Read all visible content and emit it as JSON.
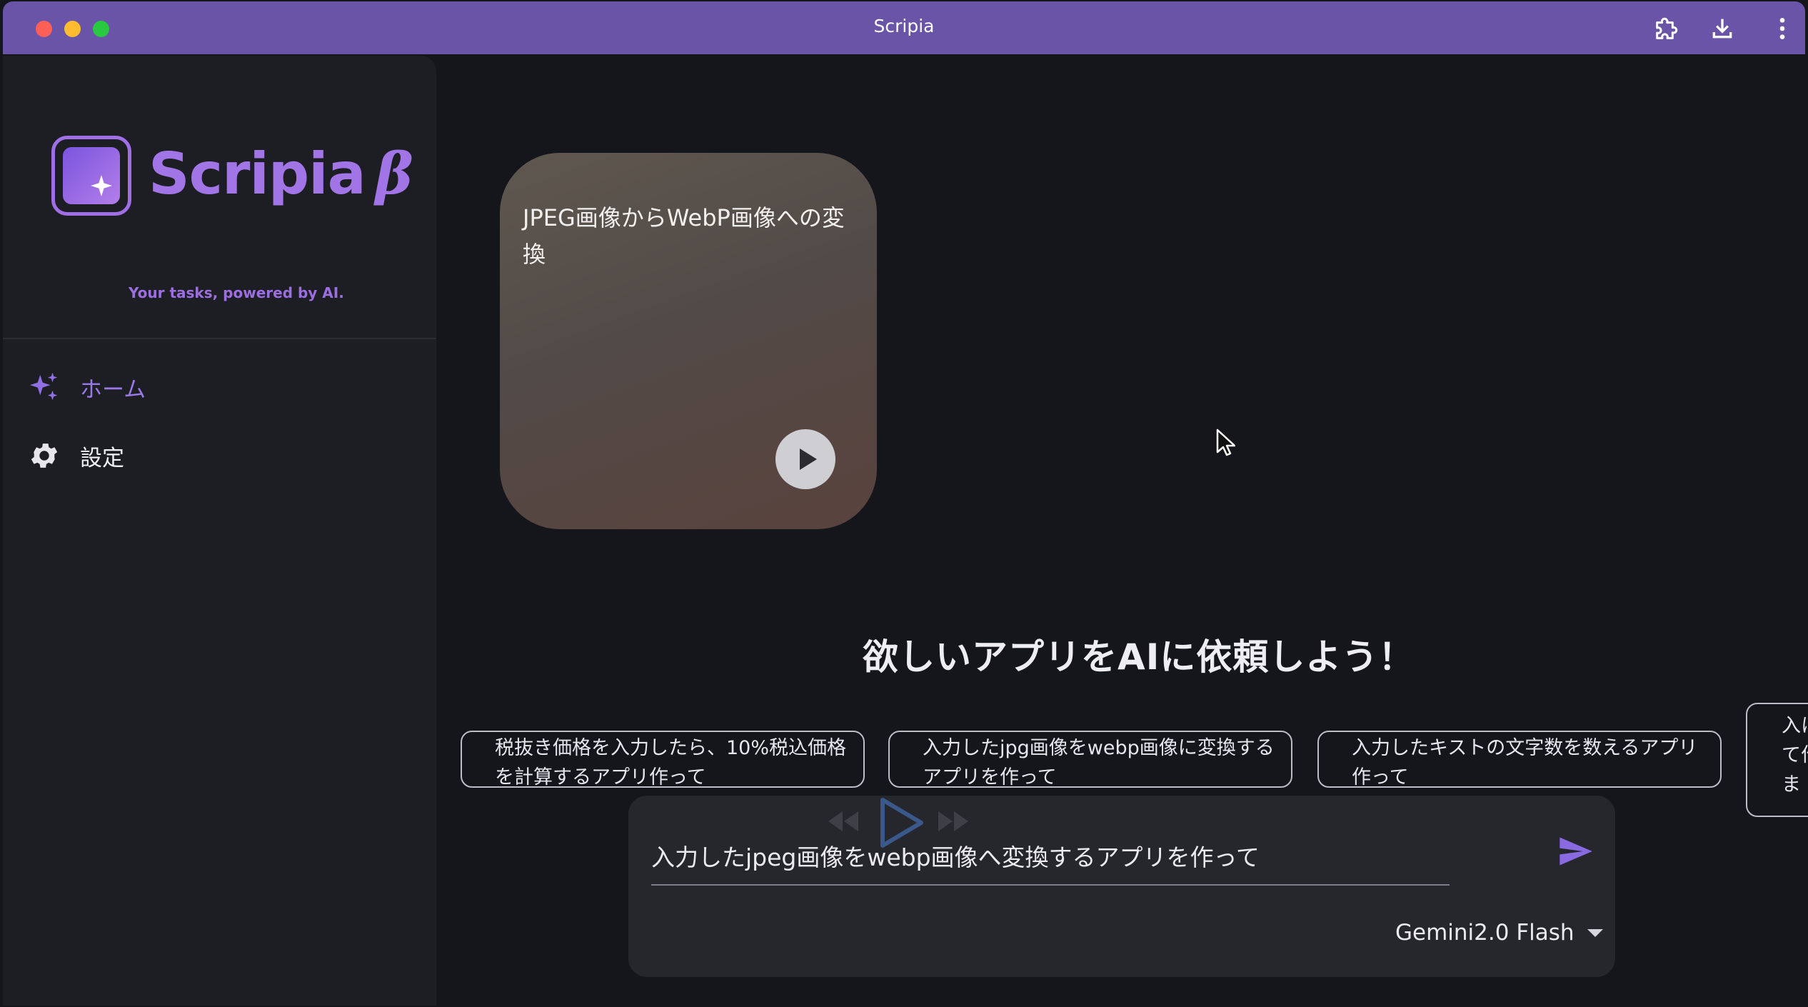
{
  "window": {
    "title": "Scripia",
    "titlebar_color": "#6a54a8",
    "icons": [
      "extension-icon",
      "download-icon",
      "more-vert-icon"
    ]
  },
  "sidebar": {
    "logo_text": "Scripia",
    "logo_beta": "β",
    "tagline": "Your tasks, powered by AI.",
    "accent_color": "#a275e6",
    "nav": [
      {
        "label": "ホーム",
        "icon": "sparkle-icon",
        "active": true
      },
      {
        "label": "設定",
        "icon": "gear-icon",
        "active": false
      }
    ]
  },
  "main": {
    "card": {
      "title": "JPEG画像からWebP画像への変換",
      "action_icon": "play-icon"
    },
    "heading": "欲しいアプリをAIに依頼しよう！",
    "suggestions": [
      "税抜き価格を入力したら、10%税込価格を計算するアプリ作って",
      "入力したjpg画像をwebp画像に変換するアプリを作って",
      "入力したキストの文字数を数えるアプリ作って",
      "入にて作ま"
    ]
  },
  "input": {
    "value": "入力したjpeg画像をwebp画像へ変換するアプリを作って",
    "send_icon": "send-icon",
    "model": "Gemini2.0 Flash"
  }
}
